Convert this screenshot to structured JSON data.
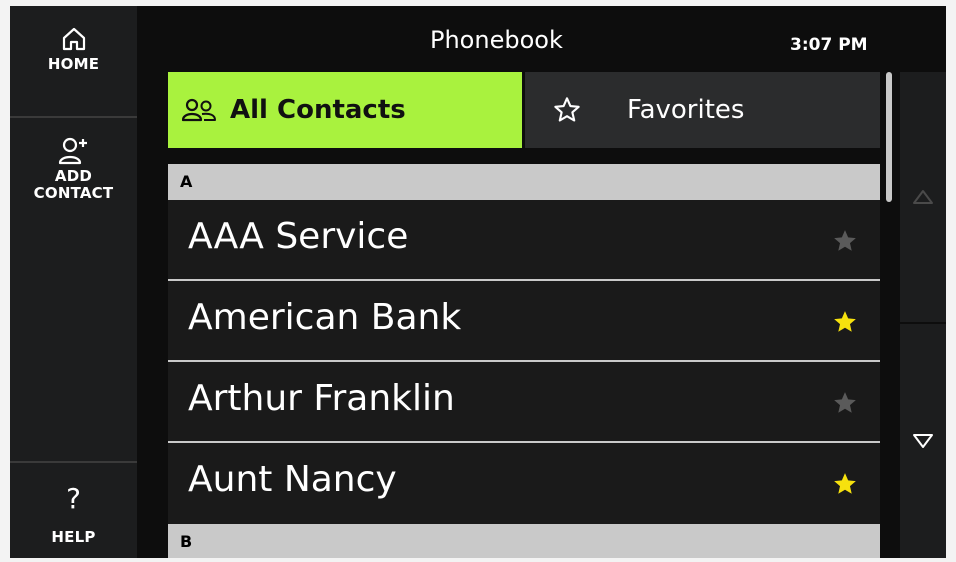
{
  "header": {
    "title": "Phonebook",
    "time": "3:07 PM"
  },
  "sidebar": {
    "home_label": "HOME",
    "add_contact_label": "ADD\nCONTACT",
    "help_label": "HELP",
    "help_glyph": "?"
  },
  "tabs": {
    "all_contacts": "All Contacts",
    "favorites": "Favorites",
    "active": "all_contacts"
  },
  "sections": [
    {
      "letter": "A",
      "contacts": [
        {
          "name": "AAA Service",
          "favorite": false
        },
        {
          "name": "American Bank",
          "favorite": true
        },
        {
          "name": "Arthur Franklin",
          "favorite": false
        },
        {
          "name": "Aunt Nancy",
          "favorite": true
        }
      ]
    },
    {
      "letter": "B",
      "contacts": []
    }
  ],
  "colors": {
    "accent": "#a9f23e",
    "favorite_star": "#f6e10e",
    "non_favorite_star": "#5a5a5a",
    "section_header": "#c9c9c9"
  }
}
